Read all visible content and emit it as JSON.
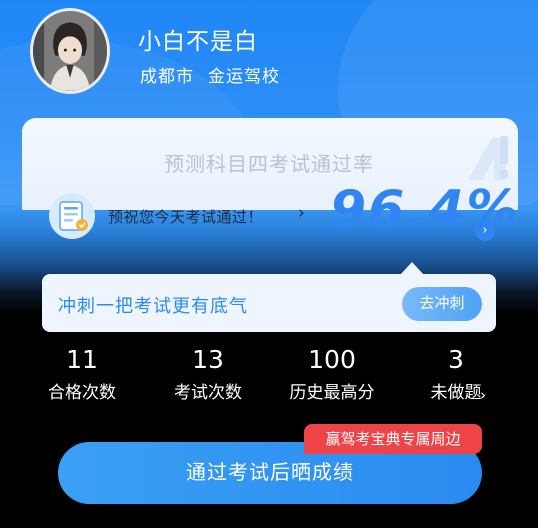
{
  "profile": {
    "username": "小白不是白",
    "city": "成都市",
    "school": "金运驾校"
  },
  "prediction": {
    "title": "预测科目四考试通过率",
    "wish": "预祝您今天考试通过！",
    "rate": "96.4%"
  },
  "sprint": {
    "text": "冲刺一把考试更有底气",
    "button": "去冲刺"
  },
  "stats": [
    {
      "value": "11",
      "label": "合格次数"
    },
    {
      "value": "13",
      "label": "考试次数"
    },
    {
      "value": "100",
      "label": "历史最高分"
    },
    {
      "value": "3",
      "label": "未做题"
    }
  ],
  "promo_tag": "赢驾考宝典专属周边",
  "main_button": "通过考试后晒成绩",
  "colors": {
    "accent": "#2f86f2",
    "promo": "#ef4447"
  }
}
